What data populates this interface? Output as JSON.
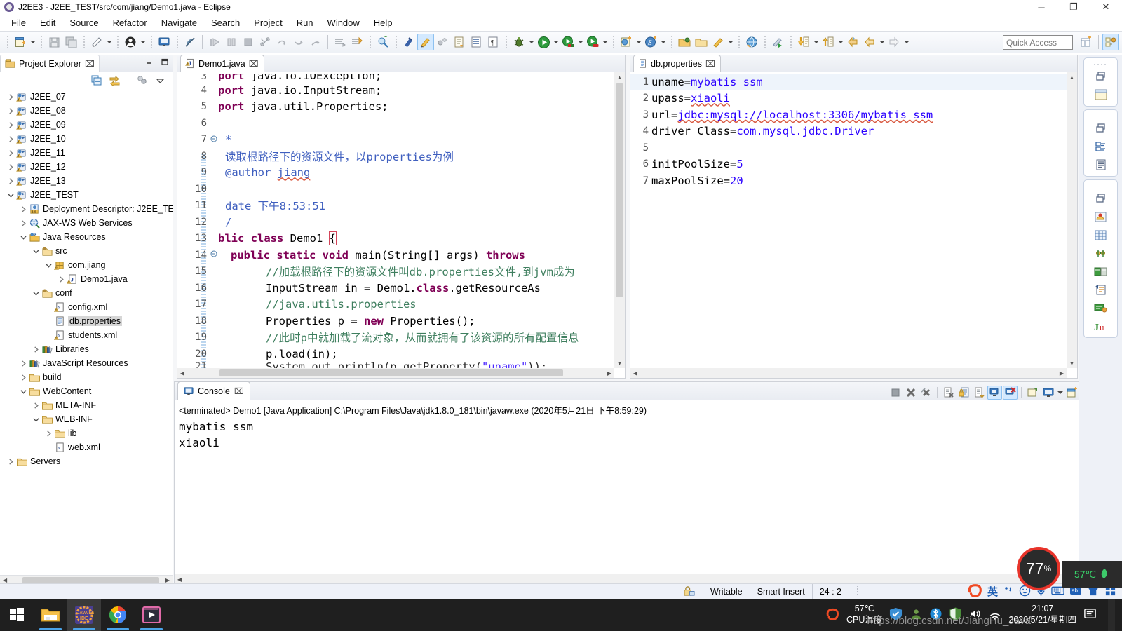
{
  "window": {
    "title": "J2EE3 - J2EE_TEST/src/com/jiang/Demo1.java - Eclipse",
    "minimize": "─",
    "maximize": "❐",
    "close": "✕"
  },
  "menubar": {
    "items": [
      "File",
      "Edit",
      "Source",
      "Refactor",
      "Navigate",
      "Search",
      "Project",
      "Run",
      "Window",
      "Help"
    ]
  },
  "toolbar": {
    "quick_access_placeholder": "Quick Access",
    "icons": [
      "new-wizard-icon",
      "save-icon",
      "save-all-icon",
      "publish-icon",
      "user-icon",
      "console-icon",
      "no-link-icon",
      "step-into-icon",
      "pause-icon",
      "terminate-icon",
      "skip-breakpoints-icon",
      "step-over-icon",
      "step-return-icon",
      "step-out-icon",
      "open-task-icon",
      "next-annotation-icon",
      "search-icon",
      "link-icon",
      "external-tools-icon",
      "open-type-icon",
      "toggle-block-icon",
      "show-whitespace-icon",
      "debug-icon",
      "run-icon",
      "run-server-icon",
      "run-stop-icon",
      "new-web-icon",
      "spring-icon",
      "open-perspective-icon",
      "open-folder-icon",
      "pencil-icon",
      "globe-icon",
      "profile-icon",
      "import-icon",
      "export-icon",
      "back-icon",
      "forward-icon"
    ]
  },
  "perspective_switch": {
    "icons": [
      "open-perspective-icon",
      "j2ee-perspective-icon"
    ]
  },
  "explorer": {
    "tab_label": "Project Explorer",
    "tab_close": "⌧",
    "toolbar_icons": [
      "collapse-all-icon",
      "link-with-editor-icon",
      "view-menu-filters-icon",
      "view-menu-icon"
    ],
    "minimize": "━",
    "maximize": "❐",
    "tree": [
      {
        "label": "J2EE_07",
        "depth": 0,
        "twisty": "collapsed",
        "icon": "java-project-warning-icon"
      },
      {
        "label": "J2EE_08",
        "depth": 0,
        "twisty": "collapsed",
        "icon": "java-project-warning-icon"
      },
      {
        "label": "J2EE_09",
        "depth": 0,
        "twisty": "collapsed",
        "icon": "java-project-warning-icon"
      },
      {
        "label": "J2EE_10",
        "depth": 0,
        "twisty": "collapsed",
        "icon": "java-project-warning-icon"
      },
      {
        "label": "J2EE_11",
        "depth": 0,
        "twisty": "collapsed",
        "icon": "java-project-warning-icon"
      },
      {
        "label": "J2EE_12",
        "depth": 0,
        "twisty": "collapsed",
        "icon": "java-project-warning-icon"
      },
      {
        "label": "J2EE_13",
        "depth": 0,
        "twisty": "collapsed",
        "icon": "java-project-warning-icon"
      },
      {
        "label": "J2EE_TEST",
        "depth": 0,
        "twisty": "expanded",
        "icon": "java-project-warning-icon"
      },
      {
        "label": "Deployment Descriptor: J2EE_TE",
        "depth": 1,
        "twisty": "collapsed",
        "icon": "deployment-descriptor-icon"
      },
      {
        "label": "JAX-WS Web Services",
        "depth": 1,
        "twisty": "collapsed",
        "icon": "web-services-icon"
      },
      {
        "label": "Java Resources",
        "depth": 1,
        "twisty": "expanded",
        "icon": "java-resources-icon"
      },
      {
        "label": "src",
        "depth": 2,
        "twisty": "expanded",
        "icon": "source-folder-icon"
      },
      {
        "label": "com.jiang",
        "depth": 3,
        "twisty": "expanded",
        "icon": "package-warning-icon"
      },
      {
        "label": "Demo1.java",
        "depth": 4,
        "twisty": "collapsed",
        "icon": "java-file-warning-icon"
      },
      {
        "label": "conf",
        "depth": 2,
        "twisty": "expanded",
        "icon": "source-folder-icon"
      },
      {
        "label": "config.xml",
        "depth": 3,
        "twisty": "none",
        "icon": "xml-file-warning-icon"
      },
      {
        "label": "db.properties",
        "depth": 3,
        "twisty": "none",
        "icon": "properties-file-icon",
        "selected": true
      },
      {
        "label": "students.xml",
        "depth": 3,
        "twisty": "none",
        "icon": "xml-file-warning-icon"
      },
      {
        "label": "Libraries",
        "depth": 2,
        "twisty": "collapsed",
        "icon": "libraries-icon"
      },
      {
        "label": "JavaScript Resources",
        "depth": 1,
        "twisty": "collapsed",
        "icon": "libraries-icon"
      },
      {
        "label": "build",
        "depth": 1,
        "twisty": "collapsed",
        "icon": "folder-icon"
      },
      {
        "label": "WebContent",
        "depth": 1,
        "twisty": "expanded",
        "icon": "folder-icon"
      },
      {
        "label": "META-INF",
        "depth": 2,
        "twisty": "collapsed",
        "icon": "folder-icon"
      },
      {
        "label": "WEB-INF",
        "depth": 2,
        "twisty": "expanded",
        "icon": "folder-icon"
      },
      {
        "label": "lib",
        "depth": 3,
        "twisty": "collapsed",
        "icon": "folder-icon"
      },
      {
        "label": "web.xml",
        "depth": 3,
        "twisty": "none",
        "icon": "xml-file-icon"
      },
      {
        "label": "Servers",
        "depth": 0,
        "twisty": "collapsed",
        "icon": "folder-icon"
      }
    ]
  },
  "editor_java": {
    "tab_label": "Demo1.java",
    "tab_icon": "java-file-warning-icon",
    "tab_close": "⌧",
    "lines": [
      {
        "num": "3",
        "text": "port java.io.IOException;",
        "kind": "import-clipped-top"
      },
      {
        "num": "4",
        "text": "port java.io.InputStream;",
        "kind": "import"
      },
      {
        "num": "5",
        "text": "port java.util.Properties;",
        "kind": "import"
      },
      {
        "num": "6",
        "text": "",
        "kind": "blank"
      },
      {
        "num": "7",
        "text": "*",
        "kind": "javadoc",
        "fold": true
      },
      {
        "num": "8",
        "text": "读取根路径下的资源文件，以properties为例",
        "kind": "javadoc"
      },
      {
        "num": "9",
        "text": "@author jiang",
        "kind": "javadoc-author"
      },
      {
        "num": "10",
        "text": "",
        "kind": "blank"
      },
      {
        "num": "11",
        "text": "date 下午8:53:51",
        "kind": "javadoc"
      },
      {
        "num": "12",
        "text": "/",
        "kind": "javadoc"
      },
      {
        "num": "13",
        "text": "blic class Demo1 {",
        "kind": "class-decl"
      },
      {
        "num": "14",
        "text": "public static void main(String[] args) throws",
        "kind": "method-decl",
        "fold": true
      },
      {
        "num": "15",
        "text": "//加载根路径下的资源文件叫db.properties文件,到jvm成为",
        "kind": "comment"
      },
      {
        "num": "16",
        "text": "InputStream in = Demo1.class.getResourceAs",
        "kind": "code-stream"
      },
      {
        "num": "17",
        "text": "//java.utils.properties",
        "kind": "comment"
      },
      {
        "num": "18",
        "text": "Properties p = new Properties();",
        "kind": "code-props"
      },
      {
        "num": "19",
        "text": "//此时p中就加载了流对象，从而就拥有了该资源的所有配置信息",
        "kind": "comment"
      },
      {
        "num": "20",
        "text": "p.load(in);",
        "kind": "code-load"
      },
      {
        "num": "21",
        "text": "System.out.println(p.getProperty(\"uname\"));",
        "kind": "code-clipped-bottom"
      }
    ]
  },
  "editor_properties": {
    "tab_label": "db.properties",
    "tab_icon": "properties-file-icon",
    "tab_close": "⌧",
    "lines": [
      {
        "num": "1",
        "key": "uname=",
        "value": "mybatis_ssm",
        "highlight": true
      },
      {
        "num": "2",
        "key": "upass=",
        "value": "xiaoli",
        "squiggle": true
      },
      {
        "num": "3",
        "key": "url=",
        "value": "jdbc:mysql://localhost:3306/mybatis_ssm",
        "squiggle": true
      },
      {
        "num": "4",
        "key": "driver_Class=",
        "value": "com.mysql.jdbc.Driver"
      },
      {
        "num": "5",
        "key": "",
        "value": ""
      },
      {
        "num": "6",
        "key": "initPoolSize=",
        "value": "5"
      },
      {
        "num": "7",
        "key": "maxPoolSize=",
        "value": "20"
      }
    ]
  },
  "console": {
    "tab_label": "Console",
    "tab_icon": "console-icon",
    "tab_close": "⌧",
    "process_line": "<terminated> Demo1 [Java Application] C:\\Program Files\\Java\\jdk1.8.0_181\\bin\\javaw.exe (2020年5月21日 下午8:59:29)",
    "output": [
      "mybatis_ssm",
      "xiaoli"
    ],
    "tools": [
      "terminate-icon",
      "remove-launch-icon",
      "remove-all-terminated-icon",
      "clear-console-icon",
      "scroll-lock-icon",
      "show-console-on-output-icon",
      "pin-console-icon",
      "display-selected-console-icon",
      "open-console-icon",
      "new-console-view-icon",
      "minimize-icon",
      "maximize-icon"
    ]
  },
  "statusbar": {
    "lock_icon": "writable-lock-icon",
    "writable": "Writable",
    "insert_mode": "Smart Insert",
    "cursor_position": "24 : 2",
    "ime": {
      "logo": "sogou-logo-icon",
      "lang": "英",
      "items": [
        "punctuation-icon",
        "emoji-icon",
        "microphone-icon",
        "keyboard-icon",
        "translate-icon",
        "skin-icon",
        "toolbox-icon"
      ]
    }
  },
  "cpu_gadget": {
    "usage": "77",
    "usage_unit": "%",
    "temperature": "57℃",
    "leaf_icon": "leaf-icon"
  },
  "taskbar": {
    "start_icon": "windows-start-icon",
    "apps": [
      {
        "icon": "file-explorer-icon",
        "active": false
      },
      {
        "icon": "eclipse-j2ee-ide-icon",
        "active": true
      },
      {
        "icon": "chrome-icon",
        "active": false
      },
      {
        "icon": "media-player-icon",
        "active": false
      }
    ],
    "tray": {
      "sogou_icon": "sogou-logo-icon",
      "cpu_temp": "57℃",
      "cpu_temp_label": "CPU温度",
      "icons": [
        "tencent-pc-manager-icon",
        "nvidia-icon",
        "bluetooth-icon",
        "windows-defender-icon",
        "volume-icon",
        "network-icon"
      ],
      "time": "21:07",
      "date": "2020/5/21/星期四",
      "notification_icon": "action-center-icon"
    }
  },
  "watermark": "https://blog.csdn.net/JiangHu_Java",
  "colors": {
    "keyword": "#7f0055",
    "string": "#2a00ff",
    "comment": "#3f7f5f",
    "javadoc": "#3f5fbf",
    "accent": "#4aa3e8",
    "selection": "#d6d6d6"
  }
}
